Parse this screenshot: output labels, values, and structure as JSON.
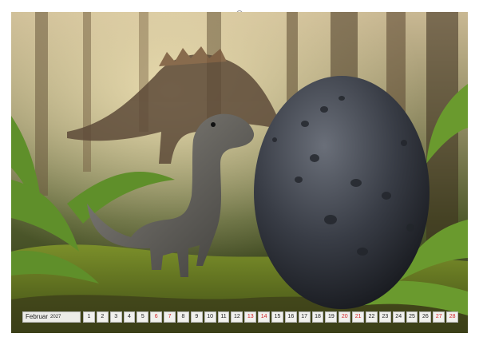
{
  "calendar": {
    "month": "Februar",
    "year": "2027",
    "weekend_color": "#d2262a",
    "days": [
      {
        "n": "1",
        "weekend": false
      },
      {
        "n": "2",
        "weekend": false
      },
      {
        "n": "3",
        "weekend": false
      },
      {
        "n": "4",
        "weekend": false
      },
      {
        "n": "5",
        "weekend": false
      },
      {
        "n": "6",
        "weekend": true
      },
      {
        "n": "7",
        "weekend": true
      },
      {
        "n": "8",
        "weekend": false
      },
      {
        "n": "9",
        "weekend": false
      },
      {
        "n": "10",
        "weekend": false
      },
      {
        "n": "11",
        "weekend": false
      },
      {
        "n": "12",
        "weekend": false
      },
      {
        "n": "13",
        "weekend": true
      },
      {
        "n": "14",
        "weekend": true
      },
      {
        "n": "15",
        "weekend": false
      },
      {
        "n": "16",
        "weekend": false
      },
      {
        "n": "17",
        "weekend": false
      },
      {
        "n": "18",
        "weekend": false
      },
      {
        "n": "19",
        "weekend": false
      },
      {
        "n": "20",
        "weekend": true
      },
      {
        "n": "21",
        "weekend": true
      },
      {
        "n": "22",
        "weekend": false
      },
      {
        "n": "23",
        "weekend": false
      },
      {
        "n": "24",
        "weekend": false
      },
      {
        "n": "25",
        "weekend": false
      },
      {
        "n": "26",
        "weekend": false
      },
      {
        "n": "27",
        "weekend": true
      },
      {
        "n": "28",
        "weekend": true
      }
    ]
  }
}
